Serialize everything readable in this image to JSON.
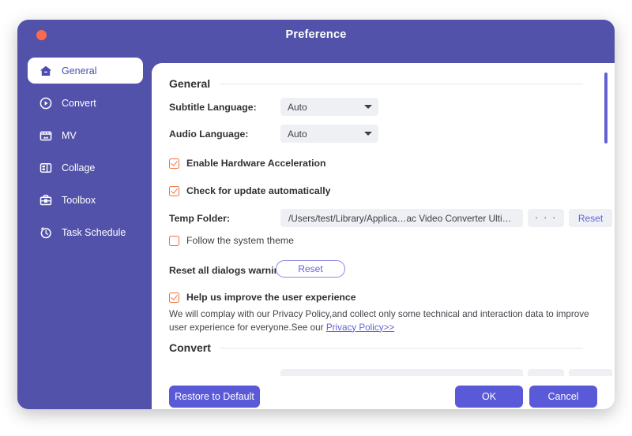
{
  "window": {
    "title": "Preference",
    "close_icon": "close-dot-icon",
    "accent_purple": "#5252ab",
    "button_purple": "#5a5ad8",
    "checkbox_orange": "#f2733f",
    "link_purple": "#6262d8"
  },
  "sidebar": {
    "items": [
      {
        "label": "General",
        "icon": "home-icon",
        "active": true
      },
      {
        "label": "Convert",
        "icon": "play-circle-icon",
        "active": false
      },
      {
        "label": "MV",
        "icon": "clapperboard-icon",
        "active": false
      },
      {
        "label": "Collage",
        "icon": "layout-grid-icon",
        "active": false
      },
      {
        "label": "Toolbox",
        "icon": "toolbox-icon",
        "active": false
      },
      {
        "label": "Task Schedule",
        "icon": "clock-icon",
        "active": false
      }
    ]
  },
  "content": {
    "section_general": "General",
    "subtitle_language_label": "Subtitle Language:",
    "subtitle_language_value": "Auto",
    "audio_language_label": "Audio Language:",
    "audio_language_value": "Auto",
    "enable_hw_accel_label": "Enable Hardware Acceleration",
    "enable_hw_accel_checked": true,
    "check_update_label": "Check for update automatically",
    "check_update_checked": true,
    "temp_folder_label": "Temp Folder:",
    "temp_folder_value": "/Users/test/Library/Applica…ac Video Converter Ultimate",
    "temp_folder_browse": "· · ·",
    "temp_folder_reset": "Reset",
    "follow_theme_label": "Follow the system theme",
    "follow_theme_checked": false,
    "reset_dialogs_label": "Reset all dialogs warnings:",
    "reset_dialogs_button": "Reset",
    "improve_experience_label": "Help us improve the user experience",
    "improve_experience_checked": true,
    "privacy_text_line1": "We will complay with our Privacy Policy,and collect only some technical and interaction data to improve user",
    "privacy_text_line2": "experience for everyone.See our ",
    "privacy_link": "Privacy Policy>>",
    "section_convert": "Convert",
    "scrollbar": "vertical-scrollbar"
  },
  "footer": {
    "restore_label": "Restore to Default",
    "ok_label": "OK",
    "cancel_label": "Cancel"
  }
}
